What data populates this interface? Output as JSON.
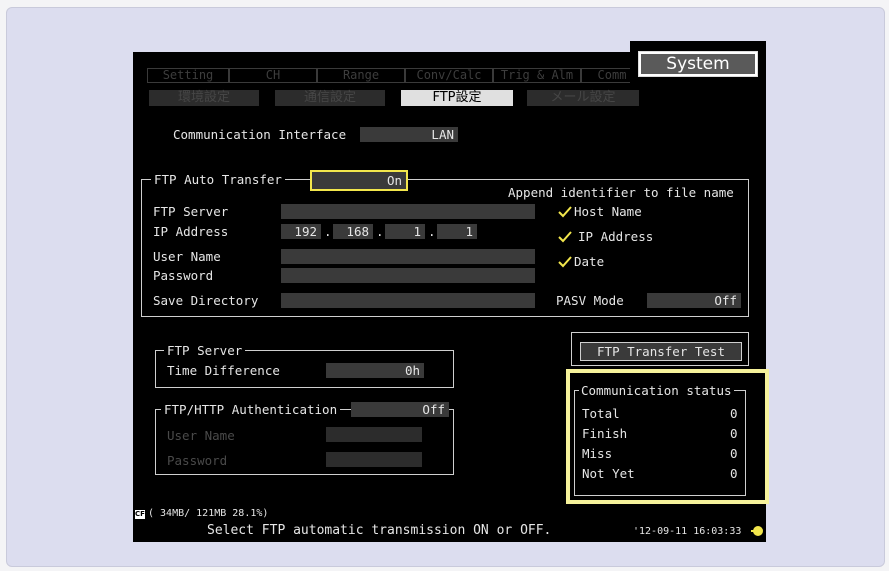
{
  "tabs": [
    "Setting",
    "CH",
    "Range",
    "Conv/Calc",
    "Trig & Alm",
    "Comm"
  ],
  "system_button": "System",
  "subtabs": [
    "環境設定",
    "通信設定",
    "FTP設定",
    "メール設定"
  ],
  "comm_interface": {
    "label": "Communication Interface",
    "value": "LAN"
  },
  "ftp_auto": {
    "label": "FTP Auto Transfer",
    "value": "On"
  },
  "append": {
    "title": "Append identifier to file name",
    "host": "Host Name",
    "ip": "IP Address",
    "date": "Date"
  },
  "fields": {
    "ftp_server": "FTP Server",
    "ip_address": "IP Address",
    "ip_octets": [
      "192",
      "168",
      "1",
      "1"
    ],
    "user_name": "User Name",
    "password": "Password",
    "save_directory": "Save Directory"
  },
  "pasv": {
    "label": "PASV Mode",
    "value": "Off"
  },
  "ftp_test_button": "FTP Transfer Test",
  "ftp_server_group": {
    "title": "FTP Server",
    "label": "Time Difference",
    "value": "0h"
  },
  "auth_group": {
    "title": "FTP/HTTP Authentication",
    "value": "Off",
    "user": "User Name",
    "password": "Password"
  },
  "comm_status": {
    "title": "Communication status",
    "rows": [
      {
        "label": "Total",
        "value": "0"
      },
      {
        "label": "Finish",
        "value": "0"
      },
      {
        "label": "Miss",
        "value": "0"
      },
      {
        "label": "Not Yet",
        "value": "0"
      }
    ]
  },
  "status_bar": {
    "media": "CF",
    "storage": "( 34MB/ 121MB 28.1%)",
    "message": "Select FTP automatic transmission ON or OFF.",
    "datetime": "'12-09-11 16:03:33"
  },
  "colors": {
    "highlight": "#f6f29b",
    "check": "#f2e64c",
    "field": "#3a3a3a"
  }
}
